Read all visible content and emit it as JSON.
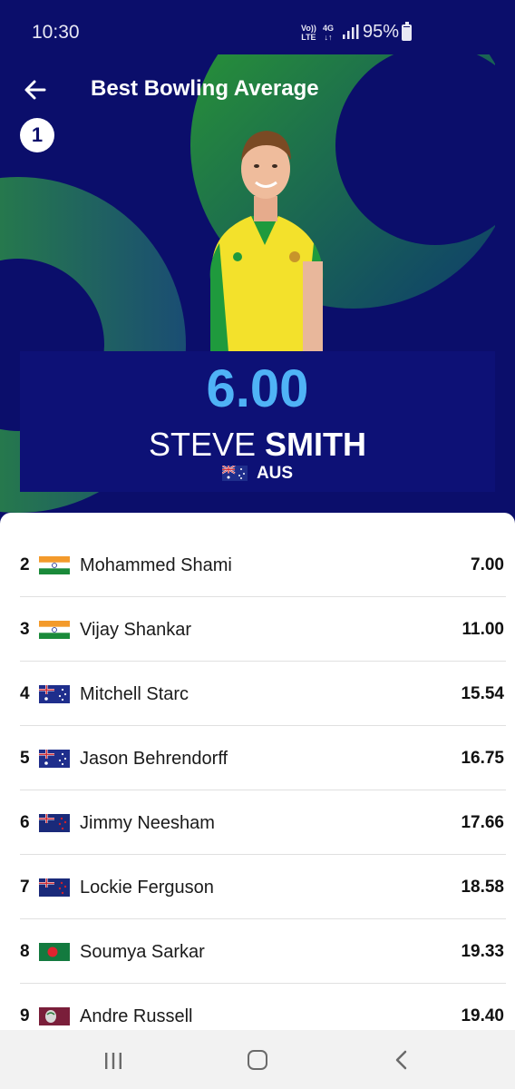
{
  "status_bar": {
    "time": "10:30",
    "network_top": "Vo))",
    "network_bottom": "LTE",
    "data_type": "4G",
    "battery_percent": "95%"
  },
  "header": {
    "title": "Best Bowling Average",
    "back_icon": "arrow-left-icon"
  },
  "leader": {
    "rank": "1",
    "value": "6.00",
    "first_name": "STEVE",
    "last_name": "SMITH",
    "country": "AUS",
    "flag": "australia-flag-icon"
  },
  "leaderboard": [
    {
      "rank": "2",
      "flag": "india",
      "name": "Mohammed Shami",
      "value": "7.00"
    },
    {
      "rank": "3",
      "flag": "india",
      "name": "Vijay Shankar",
      "value": "11.00"
    },
    {
      "rank": "4",
      "flag": "australia",
      "name": "Mitchell Starc",
      "value": "15.54"
    },
    {
      "rank": "5",
      "flag": "australia",
      "name": "Jason Behrendorff",
      "value": "16.75"
    },
    {
      "rank": "6",
      "flag": "new-zealand",
      "name": "Jimmy Neesham",
      "value": "17.66"
    },
    {
      "rank": "7",
      "flag": "new-zealand",
      "name": "Lockie Ferguson",
      "value": "18.58"
    },
    {
      "rank": "8",
      "flag": "bangladesh",
      "name": "Soumya Sarkar",
      "value": "19.33"
    },
    {
      "rank": "9",
      "flag": "west-indies",
      "name": "Andre Russell",
      "value": "19.40"
    }
  ],
  "nav_bar": {
    "recents_icon": "recents-icon",
    "home_icon": "home-icon",
    "back_icon": "back-chevron-icon"
  },
  "colors": {
    "hero_background": "#0b0e6b",
    "score_card": "#0d1176",
    "accent_blue": "#4fb3f6",
    "green_shape": "#1f8a3a"
  }
}
